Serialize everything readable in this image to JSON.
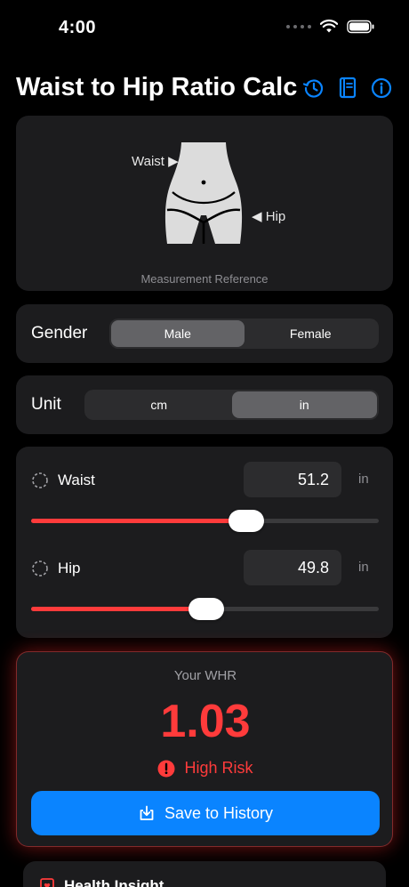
{
  "status_bar": {
    "time": "4:00"
  },
  "header": {
    "title": "Waist to Hip Ratio Calc"
  },
  "illustration": {
    "waist_label": "Waist ▶",
    "hip_label": "◀ Hip",
    "caption": "Measurement Reference"
  },
  "gender": {
    "label": "Gender",
    "options": [
      "Male",
      "Female"
    ],
    "selected": "Male"
  },
  "unit": {
    "label": "Unit",
    "options": [
      "cm",
      "in"
    ],
    "selected": "in"
  },
  "measurements": {
    "waist": {
      "label": "Waist",
      "value": "51.2",
      "unit": "in",
      "slider_fraction": 0.62
    },
    "hip": {
      "label": "Hip",
      "value": "49.8",
      "unit": "in",
      "slider_fraction": 0.505
    }
  },
  "result": {
    "label": "Your WHR",
    "value": "1.03",
    "risk": "High Risk",
    "save_label": "Save to History"
  },
  "insight": {
    "title": "Health Insight"
  },
  "colors": {
    "accent": "#0a84ff",
    "danger": "#ff3b3b",
    "card": "#1c1c1e"
  }
}
